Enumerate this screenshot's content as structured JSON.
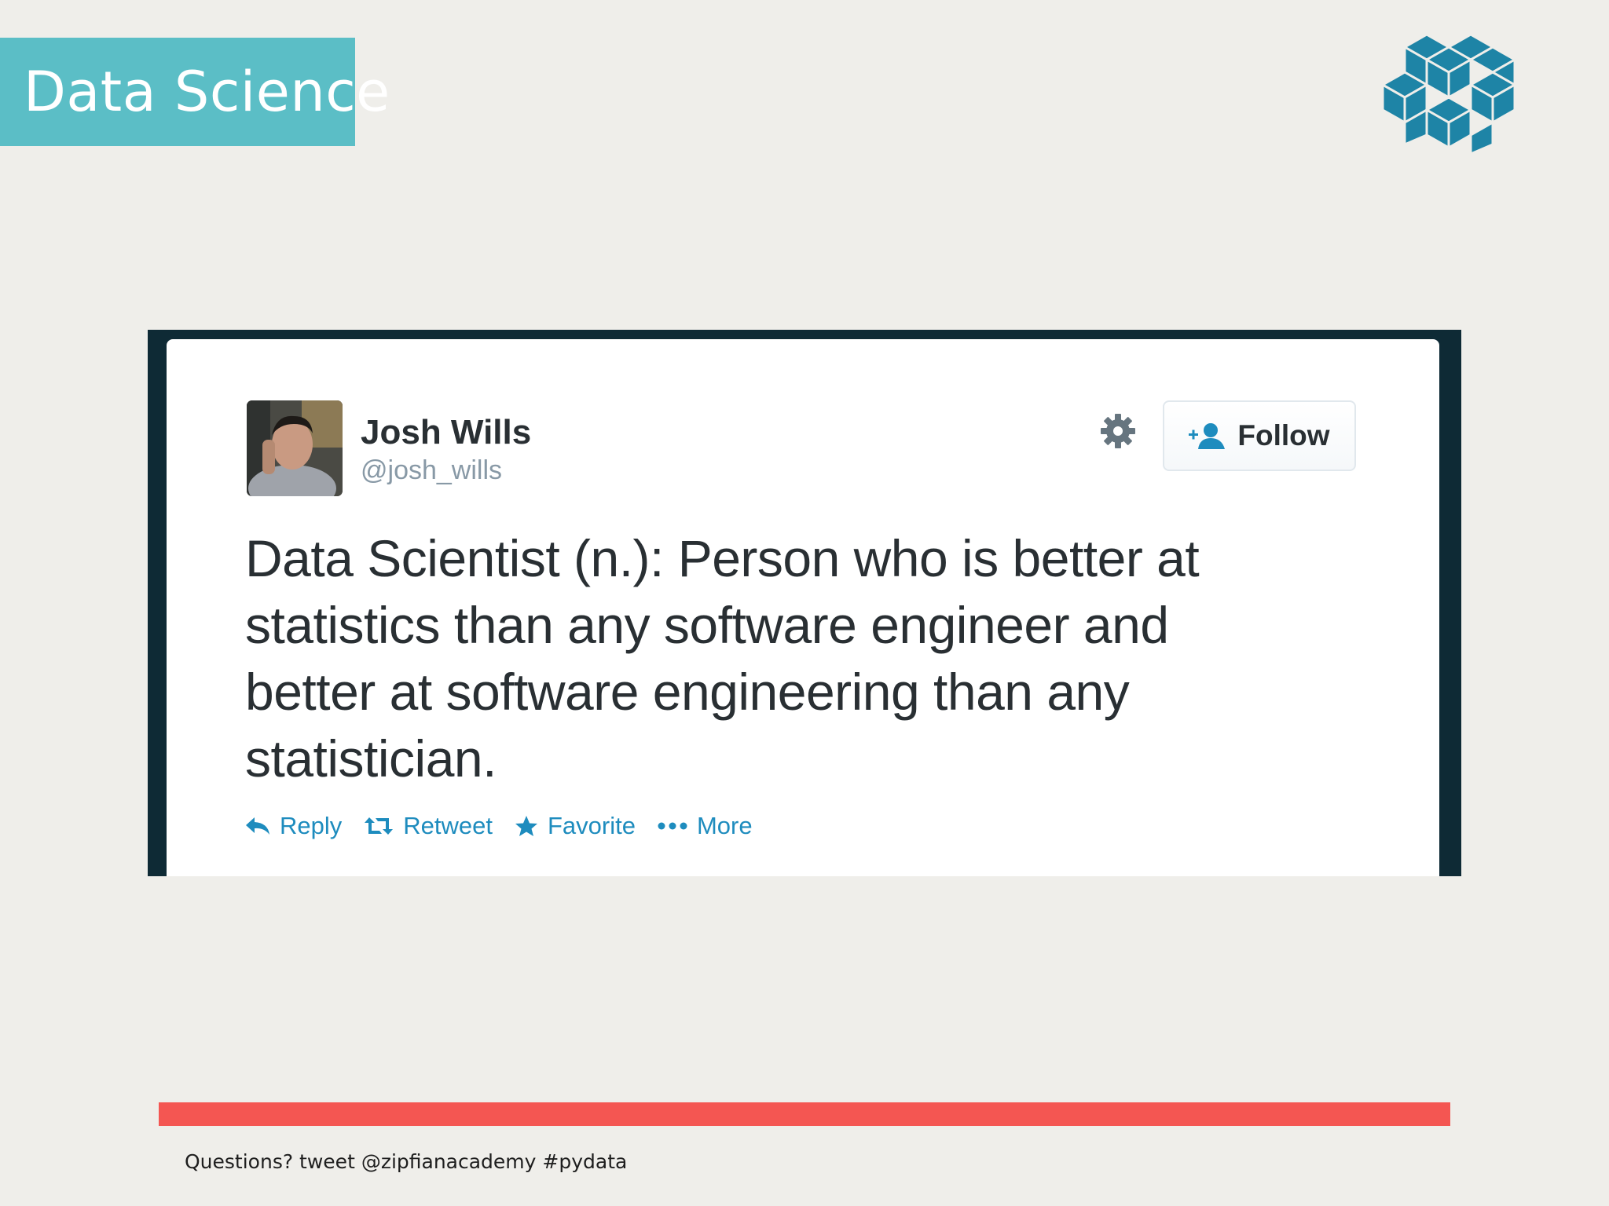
{
  "slide": {
    "title": "Data Science",
    "footer": "Questions? tweet @zipfianacademy #pydata",
    "colors": {
      "background": "#EFEEEA",
      "title_box": "#5BBEC6",
      "accent_bar": "#F45652",
      "logo": "#1E84A6",
      "tweet_frame": "#0E2A35"
    },
    "logo_icon": "isometric-cube-knot-logo"
  },
  "tweet": {
    "author_name": "Josh Wills",
    "author_handle": "@josh_wills",
    "avatar_icon": "user-avatar-photo",
    "settings_icon": "gear-icon",
    "follow_label": "Follow",
    "follow_icon": "add-user-icon",
    "text": "Data Scientist (n.): Person who is better at statistics than any software engineer and better at software engineering than any statistician.",
    "actions": [
      {
        "label": "Reply",
        "icon": "reply-icon"
      },
      {
        "label": "Retweet",
        "icon": "retweet-icon"
      },
      {
        "label": "Favorite",
        "icon": "star-icon"
      },
      {
        "label": "More",
        "icon": "more-dots-icon"
      }
    ],
    "colors": {
      "name": "#292F33",
      "handle": "#8899A6",
      "action": "#1E8CBE"
    }
  }
}
